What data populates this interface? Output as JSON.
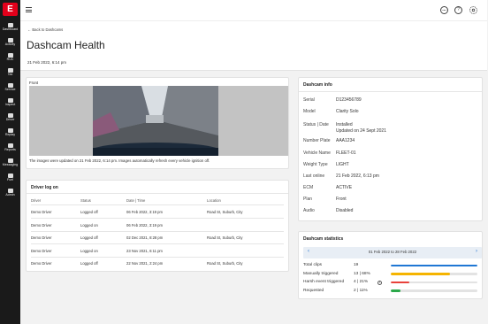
{
  "sidebar": {
    "logo": "E",
    "items": [
      {
        "label": "Dashboard",
        "icon": "dashboard-icon"
      },
      {
        "label": "Activity",
        "icon": "activity-icon"
      },
      {
        "label": "RUC",
        "icon": "ruc-icon"
      },
      {
        "label": "Tax",
        "icon": "tax-icon"
      },
      {
        "label": "Service",
        "icon": "service-icon"
      },
      {
        "label": "Inspect",
        "icon": "inspect-icon"
      },
      {
        "label": "Driver",
        "icon": "driver-icon"
      },
      {
        "label": "Replay",
        "icon": "replay-icon"
      },
      {
        "label": "Reports",
        "icon": "reports-icon"
      },
      {
        "label": "Messaging",
        "icon": "messaging-icon"
      },
      {
        "label": "Fuel",
        "icon": "fuel-icon"
      },
      {
        "label": "Admin",
        "icon": "admin-icon"
      }
    ]
  },
  "topbar": {
    "menu_icon": "hamburger-icon",
    "chat_icon": "chat-icon",
    "help_icon": "help-icon",
    "settings_icon": "gear-icon",
    "help_glyph": "?"
  },
  "header": {
    "back_link": "← Back to Dashcams",
    "title": "Dashcam Health",
    "date": "21 Feb 2022, 6:14 pm"
  },
  "camera": {
    "label": "Front",
    "note": "The images were updated on 21 Feb 2022, 6:14 pm. Images automatically refresh every vehicle ignition off."
  },
  "driver_log": {
    "title": "Driver log on",
    "columns": [
      "Driver",
      "Status",
      "Date | Time",
      "Location"
    ],
    "rows": [
      [
        "Demo Driver",
        "Logged off",
        "06 Feb 2022, 3:19 pm",
        "Road St, Suburb, City"
      ],
      [
        "Demo Driver",
        "Logged on",
        "06 Feb 2022, 3:19 pm",
        ""
      ],
      [
        "Demo Driver",
        "Logged off",
        "02 Dec 2021, 8:28 pm",
        "Road St, Suburb, City"
      ],
      [
        "Demo Driver",
        "Logged on",
        "23 Nov 2021, 6:11 pm",
        ""
      ],
      [
        "Demo Driver",
        "Logged off",
        "22 Nov 2021, 2:24 pm",
        "Road St, Suburb, City"
      ]
    ]
  },
  "dashcam_info": {
    "title": "Dashcam info",
    "rows": [
      {
        "key": "Serial",
        "value": "D123456789"
      },
      {
        "key": "Model",
        "value": "Clarity Solo"
      },
      {
        "key": "Status | Date",
        "value": "Installed",
        "value2": "Updated on 24 Sept 2021"
      },
      {
        "key": "Number Plate",
        "value": "AAA1234"
      },
      {
        "key": "Vehicle Name",
        "value": "FLEET-01"
      },
      {
        "key": "Weight Type",
        "value": "LIGHT"
      },
      {
        "key": "Last online",
        "value": "21 Feb 2022, 6:13 pm"
      },
      {
        "key": "ECM",
        "value": "ACTIVE"
      },
      {
        "key": "Plan",
        "value": "Front"
      },
      {
        "key": "Audio",
        "value": "Disabled"
      }
    ]
  },
  "statistics": {
    "title": "Dashcam statistics",
    "range": "01 Feb 2022 to 28 Feb 2022",
    "prev_icon": "chevron-left-icon",
    "next_icon": "chevron-right-icon",
    "prev_glyph": "‹",
    "next_glyph": "›",
    "info_glyph": "i",
    "rows": [
      {
        "label": "Total clips",
        "value": "19",
        "fraction": 1.0,
        "color": "#1f77d4"
      },
      {
        "label": "Manually triggered",
        "value": "13 | 68%",
        "fraction": 0.68,
        "color": "#f5b400"
      },
      {
        "label": "Harsh event triggered",
        "value": "4 | 21%",
        "fraction": 0.21,
        "color": "#e8423b"
      },
      {
        "label": "Requested",
        "value": "2 | 11%",
        "fraction": 0.11,
        "color": "#2ba84a"
      }
    ]
  }
}
